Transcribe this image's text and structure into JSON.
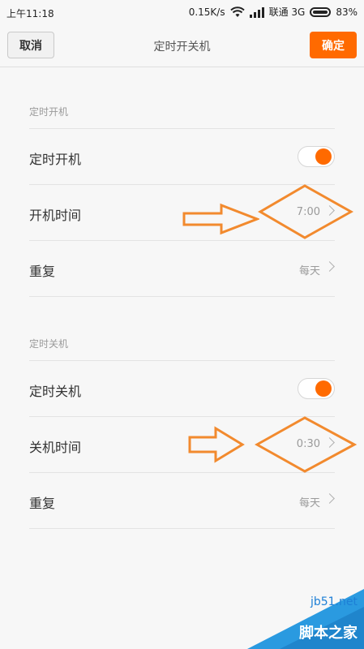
{
  "status_bar": {
    "time": "上午11:18",
    "speed": "0.15K/s",
    "carrier": "联通 3G",
    "battery": "83%"
  },
  "header": {
    "cancel_label": "取消",
    "title": "定时开关机",
    "confirm_label": "确定"
  },
  "power_on_section": {
    "header": "定时开机",
    "toggle_label": "定时开机",
    "toggle_on": true,
    "time_label": "开机时间",
    "time_value": "7:00",
    "repeat_label": "重复",
    "repeat_value": "每天"
  },
  "power_off_section": {
    "header": "定时关机",
    "toggle_label": "定时关机",
    "toggle_on": true,
    "time_label": "关机时间",
    "time_value": "0:30",
    "repeat_label": "重复",
    "repeat_value": "每天"
  },
  "watermark": {
    "domain": "jb51.net",
    "name": "脚本之家"
  },
  "colors": {
    "accent": "#ff6a00",
    "annotation": "#f28a2e"
  }
}
